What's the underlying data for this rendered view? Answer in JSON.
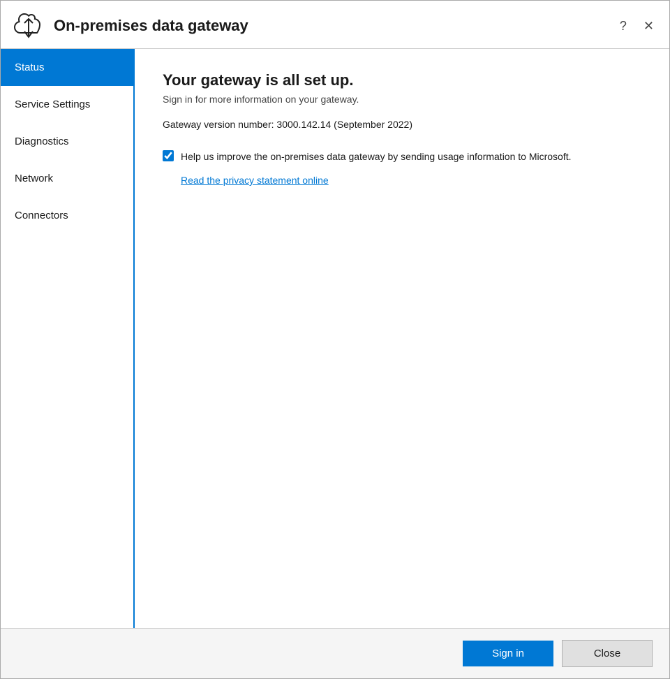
{
  "window": {
    "title": "On-premises data gateway"
  },
  "titlebar": {
    "help_label": "?",
    "close_label": "✕"
  },
  "sidebar": {
    "items": [
      {
        "id": "status",
        "label": "Status",
        "active": true
      },
      {
        "id": "service-settings",
        "label": "Service Settings",
        "active": false
      },
      {
        "id": "diagnostics",
        "label": "Diagnostics",
        "active": false
      },
      {
        "id": "network",
        "label": "Network",
        "active": false
      },
      {
        "id": "connectors",
        "label": "Connectors",
        "active": false
      }
    ]
  },
  "main": {
    "heading": "Your gateway is all set up.",
    "subtitle": "Sign in for more information on your gateway.",
    "version_text": "Gateway version number: 3000.142.14 (September 2022)",
    "checkbox_label": "Help us improve the on-premises data gateway by sending usage information to Microsoft.",
    "privacy_link": "Read the privacy statement online"
  },
  "footer": {
    "signin_label": "Sign in",
    "close_label": "Close"
  },
  "colors": {
    "accent": "#0078d4",
    "active_bg": "#0078d4",
    "active_text": "#ffffff"
  }
}
